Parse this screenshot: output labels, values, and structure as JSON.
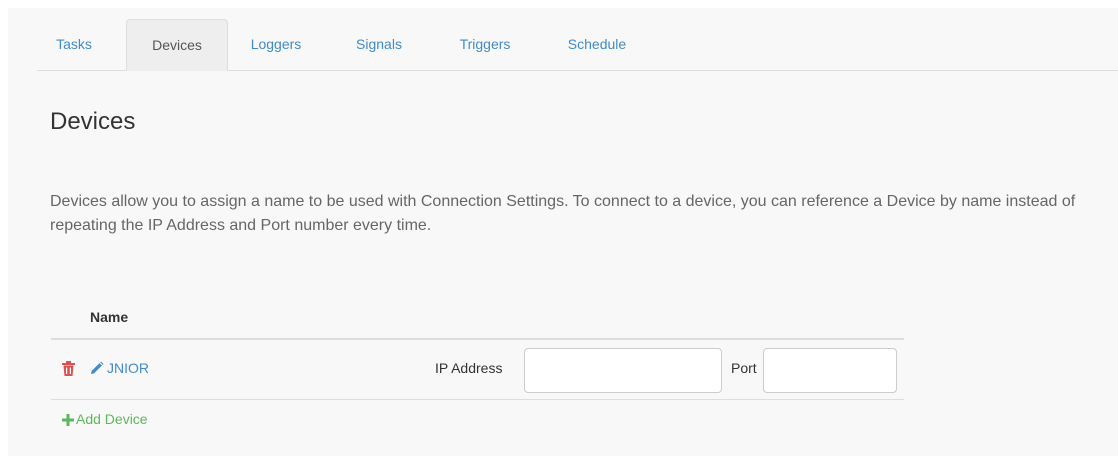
{
  "tabs": [
    {
      "label": "Tasks",
      "active": false
    },
    {
      "label": "Devices",
      "active": true
    },
    {
      "label": "Loggers",
      "active": false
    },
    {
      "label": "Signals",
      "active": false
    },
    {
      "label": "Triggers",
      "active": false
    },
    {
      "label": "Schedule",
      "active": false
    }
  ],
  "page": {
    "title": "Devices",
    "description": "Devices allow you to assign a name to be used with Connection Settings. To connect to a device, you can reference a Device by name instead of repeating the IP Address and Port number every time."
  },
  "table": {
    "header_name": "Name",
    "rows": [
      {
        "name": "JNIOR",
        "ip_label": "IP Address",
        "ip_value": "",
        "port_label": "Port",
        "port_value": ""
      }
    ],
    "add_label": "Add Device"
  },
  "icons": {
    "delete": "trash-icon",
    "edit": "pencil-icon",
    "add": "plus-icon"
  },
  "colors": {
    "link": "#428bca",
    "delete": "#d9534f",
    "add": "#5cb85c",
    "active_tab_bg": "#eeeeee"
  }
}
